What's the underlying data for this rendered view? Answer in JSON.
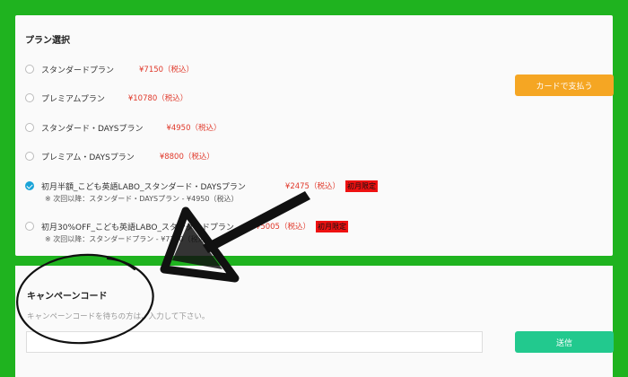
{
  "plan_section": {
    "title": "プラン選択",
    "plans": [
      {
        "name": "スタンダードプラン",
        "price": "¥7150（税込）",
        "checked": false
      },
      {
        "name": "プレミアムプラン",
        "price": "¥10780（税込）",
        "checked": false
      },
      {
        "name": "スタンダード・DAYSプラン",
        "price": "¥4950（税込）",
        "checked": false
      },
      {
        "name": "プレミアム・DAYSプラン",
        "price": "¥8800（税込）",
        "checked": false
      },
      {
        "name": "初月半額_こども英語LABO_スタンダード・DAYSプラン",
        "price": "¥2475（税込）",
        "badge": "初月限定",
        "note": "※ 次回以降：スタンダード・DAYSプラン - ¥4950（税込）",
        "checked": true
      },
      {
        "name": "初月30%OFF_こども英語LABO_スタンダードプラン",
        "price": "¥5005（税込）",
        "badge": "初月限定",
        "note": "※ 次回以降：スタンダードプラン - ¥7150（税込）",
        "checked": false
      }
    ],
    "pay_button": "カードで支払う"
  },
  "campaign_section": {
    "title": "キャンペーンコード",
    "hint": "キャンペーンコードを待ちの方は、入力して下さい。",
    "input_value": "",
    "send_button": "送信"
  },
  "colors": {
    "frame": "#1fb31f",
    "pay_button": "#f5a623",
    "send_button": "#22c98e",
    "selected_radio": "#1aa4d8",
    "price": "#e0392b"
  }
}
